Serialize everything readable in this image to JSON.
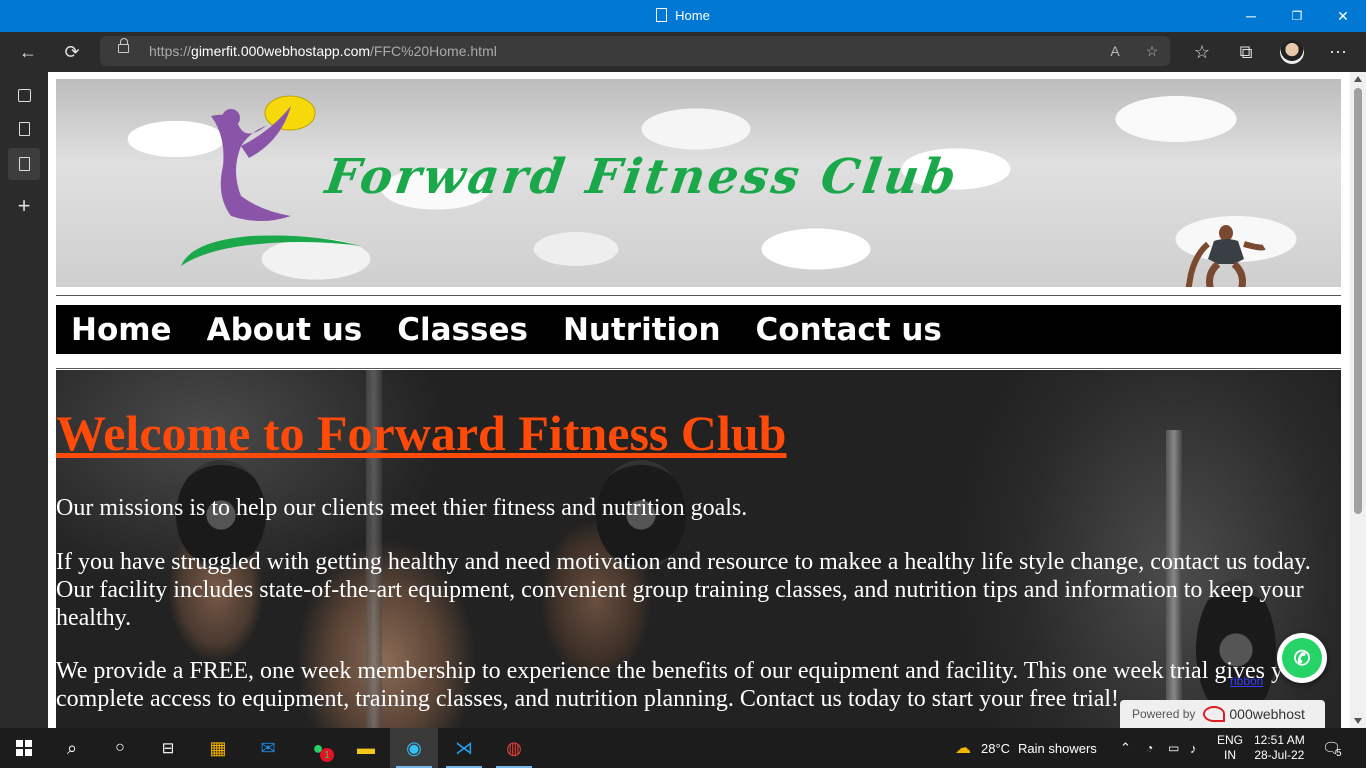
{
  "window": {
    "title": "Home",
    "minimize": "─",
    "restore": "❐",
    "close": "✕"
  },
  "address_bar": {
    "url_prefix": "https://",
    "url_host": "gimerfit.000webhostapp.com",
    "url_path": "/FFC%20Home.html"
  },
  "page": {
    "brand_title": "Forward Fitness Club",
    "nav": [
      "Home",
      "About us",
      "Classes",
      "Nutrition",
      "Contact us"
    ],
    "heading": "Welcome to Forward Fitness Club",
    "paragraph_1": "Our missions is to help our clients meet thier fitness and nutrition goals.",
    "paragraph_2": "If you have struggled with getting healthy and need motivation and resource to makee a healthy life style change, contact us today. Our facility includes state-of-the-art equipment, convenient group training classes, and nutrition tips and information to keep your healthy.",
    "paragraph_3": "We provide a FREE, one week membership to experience the benefits of our equipment and facility. This one week trial gives you complete access to equipment, training classes, and nutrition planning. Contact us today to start your free trial!",
    "overlay_link": "ribbon",
    "powered_label": "Powered by",
    "powered_host": "000webhost"
  },
  "taskbar": {
    "whatsapp_badge": "1",
    "weather_temp": "28°C",
    "weather_text": "Rain showers",
    "lang_line1": "ENG",
    "lang_line2": "IN",
    "time": "12:51 AM",
    "date": "28-Jul-22",
    "notifications": "5"
  },
  "colors": {
    "titlebar": "#0078d4",
    "heading": "#ff4a0a",
    "brand": "#1aa84a",
    "nav_bg": "#000000"
  }
}
